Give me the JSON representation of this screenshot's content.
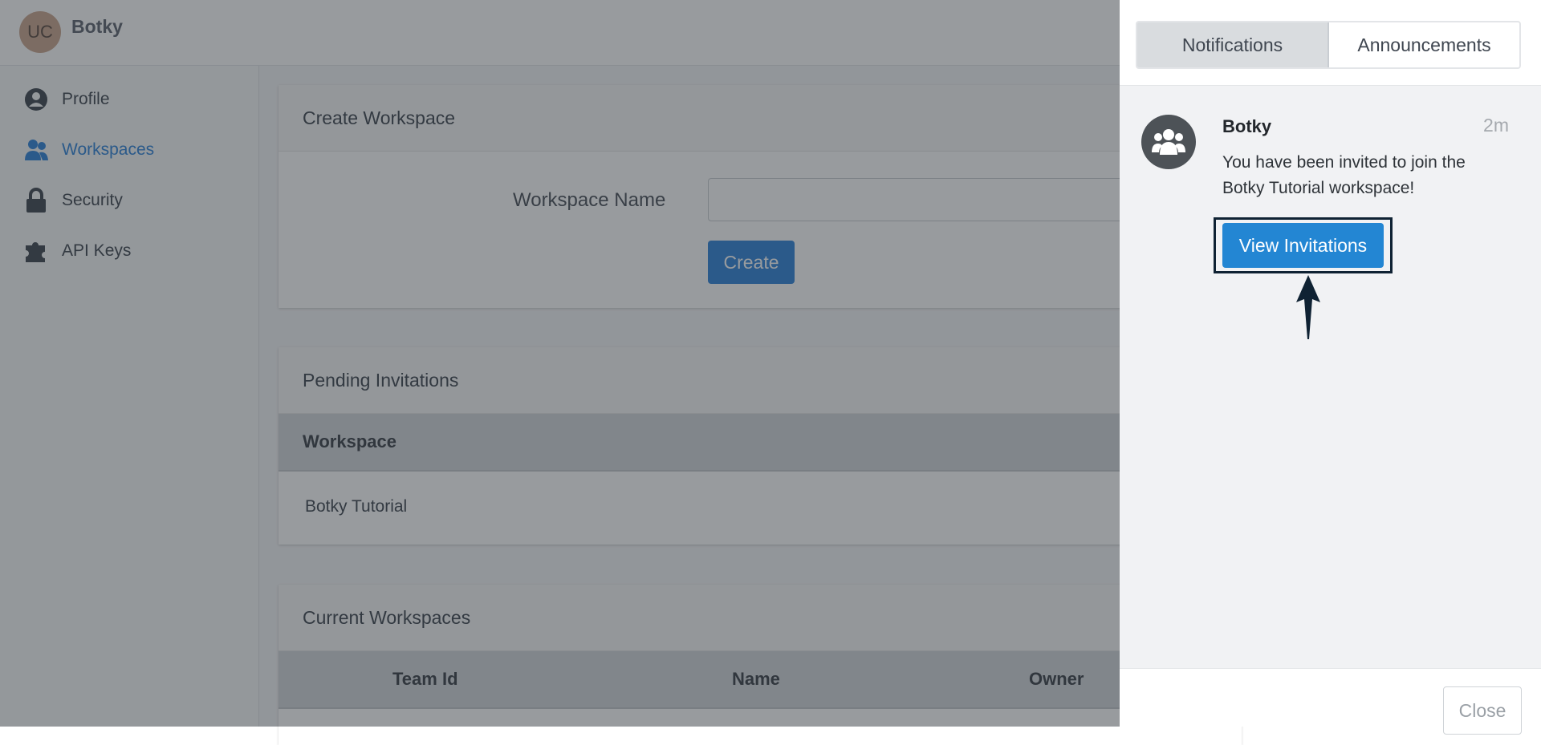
{
  "header": {
    "avatar_initials": "UC",
    "app_name": "Botky"
  },
  "sidebar": {
    "items": [
      {
        "label": "Profile",
        "icon": "user-circle-icon"
      },
      {
        "label": "Workspaces",
        "icon": "users-icon",
        "active": true
      },
      {
        "label": "Security",
        "icon": "lock-icon"
      },
      {
        "label": "API Keys",
        "icon": "puzzle-icon"
      }
    ]
  },
  "create_workspace": {
    "title": "Create Workspace",
    "field_label": "Workspace Name",
    "field_value": "",
    "button_label": "Create"
  },
  "pending_invitations": {
    "title": "Pending Invitations",
    "column_header": "Workspace",
    "rows": [
      "Botky Tutorial"
    ]
  },
  "current_workspaces": {
    "title": "Current Workspaces",
    "columns": [
      "Team Id",
      "Name",
      "Owner"
    ]
  },
  "panel": {
    "tabs": [
      "Notifications",
      "Announcements"
    ],
    "selected_tab": "Notifications",
    "notification": {
      "sender": "Botky",
      "time": "2m",
      "message": "You have been invited to join the Botky Tutorial workspace!",
      "button_label": "View Invitations"
    },
    "close_label": "Close"
  },
  "colors": {
    "accent": "#2f83d8",
    "button_blue": "#2386d3",
    "overlay": "rgba(40,45,52,0.48)",
    "highlight_border": "#0f2233"
  }
}
